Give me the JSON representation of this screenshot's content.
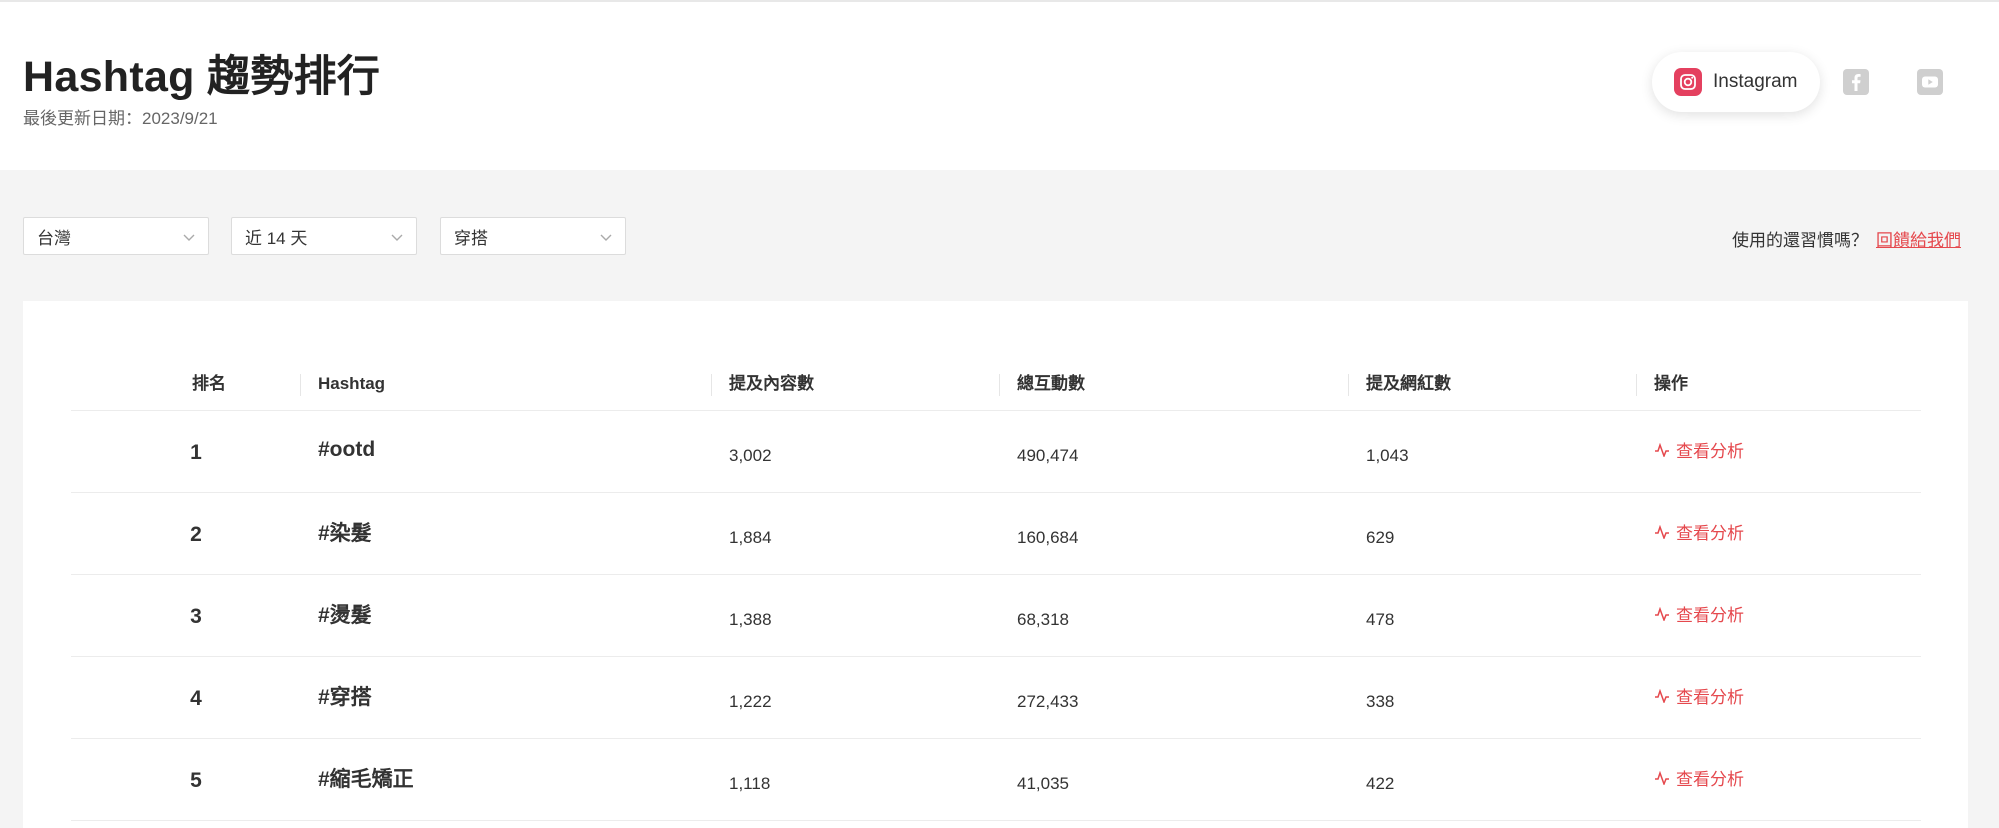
{
  "header": {
    "title": "Hashtag 趨勢排行",
    "updated": "最後更新日期：2023/9/21"
  },
  "platforms": {
    "instagram_label": "Instagram",
    "instagram_icon": "instagram-icon",
    "facebook_icon": "facebook-icon",
    "youtube_icon": "youtube-icon",
    "active": "Instagram"
  },
  "filters": {
    "region": "台灣",
    "period": "近 14 天",
    "category": "穿搭"
  },
  "feedback": {
    "question": "使用的還習慣嗎？",
    "link": "回饋給我們"
  },
  "table": {
    "headers": {
      "rank": "排名",
      "hashtag": "Hashtag",
      "posts": "提及內容數",
      "engagement": "總互動數",
      "influencers": "提及網紅數",
      "action": "操作"
    },
    "rows": [
      {
        "rank": "1",
        "hashtag": "#ootd",
        "posts": "3,002",
        "engagement": "490,474",
        "influencers": "1,043",
        "action": "查看分析"
      },
      {
        "rank": "2",
        "hashtag": "#染髮",
        "posts": "1,884",
        "engagement": "160,684",
        "influencers": "629",
        "action": "查看分析"
      },
      {
        "rank": "3",
        "hashtag": "#燙髮",
        "posts": "1,388",
        "engagement": "68,318",
        "influencers": "478",
        "action": "查看分析"
      },
      {
        "rank": "4",
        "hashtag": "#穿搭",
        "posts": "1,222",
        "engagement": "272,433",
        "influencers": "338",
        "action": "查看分析"
      },
      {
        "rank": "5",
        "hashtag": "#縮毛矯正",
        "posts": "1,118",
        "engagement": "41,035",
        "influencers": "422",
        "action": "查看分析"
      }
    ]
  },
  "colors": {
    "accent": "#e5484d",
    "instagram": "#e4405f",
    "background": "#f4f4f4"
  }
}
